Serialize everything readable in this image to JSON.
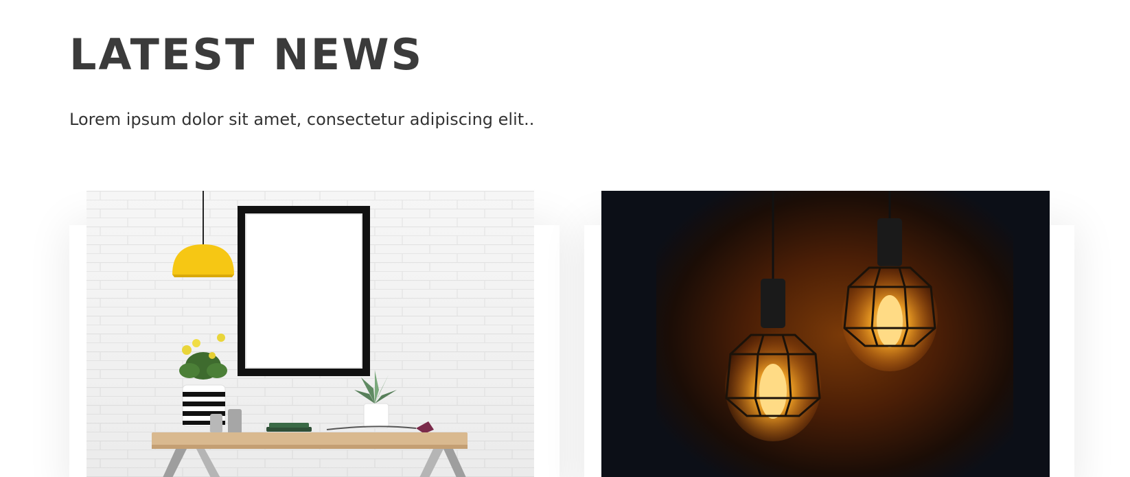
{
  "section": {
    "title": "LATEST NEWS",
    "subtitle": "Lorem ipsum dolor sit amet, consectetur adipiscing elit.."
  },
  "colors": {
    "title": "#3b3b3b",
    "text": "#333333",
    "lamp_yellow": "#f6c714",
    "bulb_glow": "#f59a1a",
    "dark_bg": "#0c0f17"
  },
  "cards": [
    {
      "image_subject": "desk-with-frame-plants-and-lamp"
    },
    {
      "image_subject": "two-hanging-cage-bulbs"
    }
  ]
}
